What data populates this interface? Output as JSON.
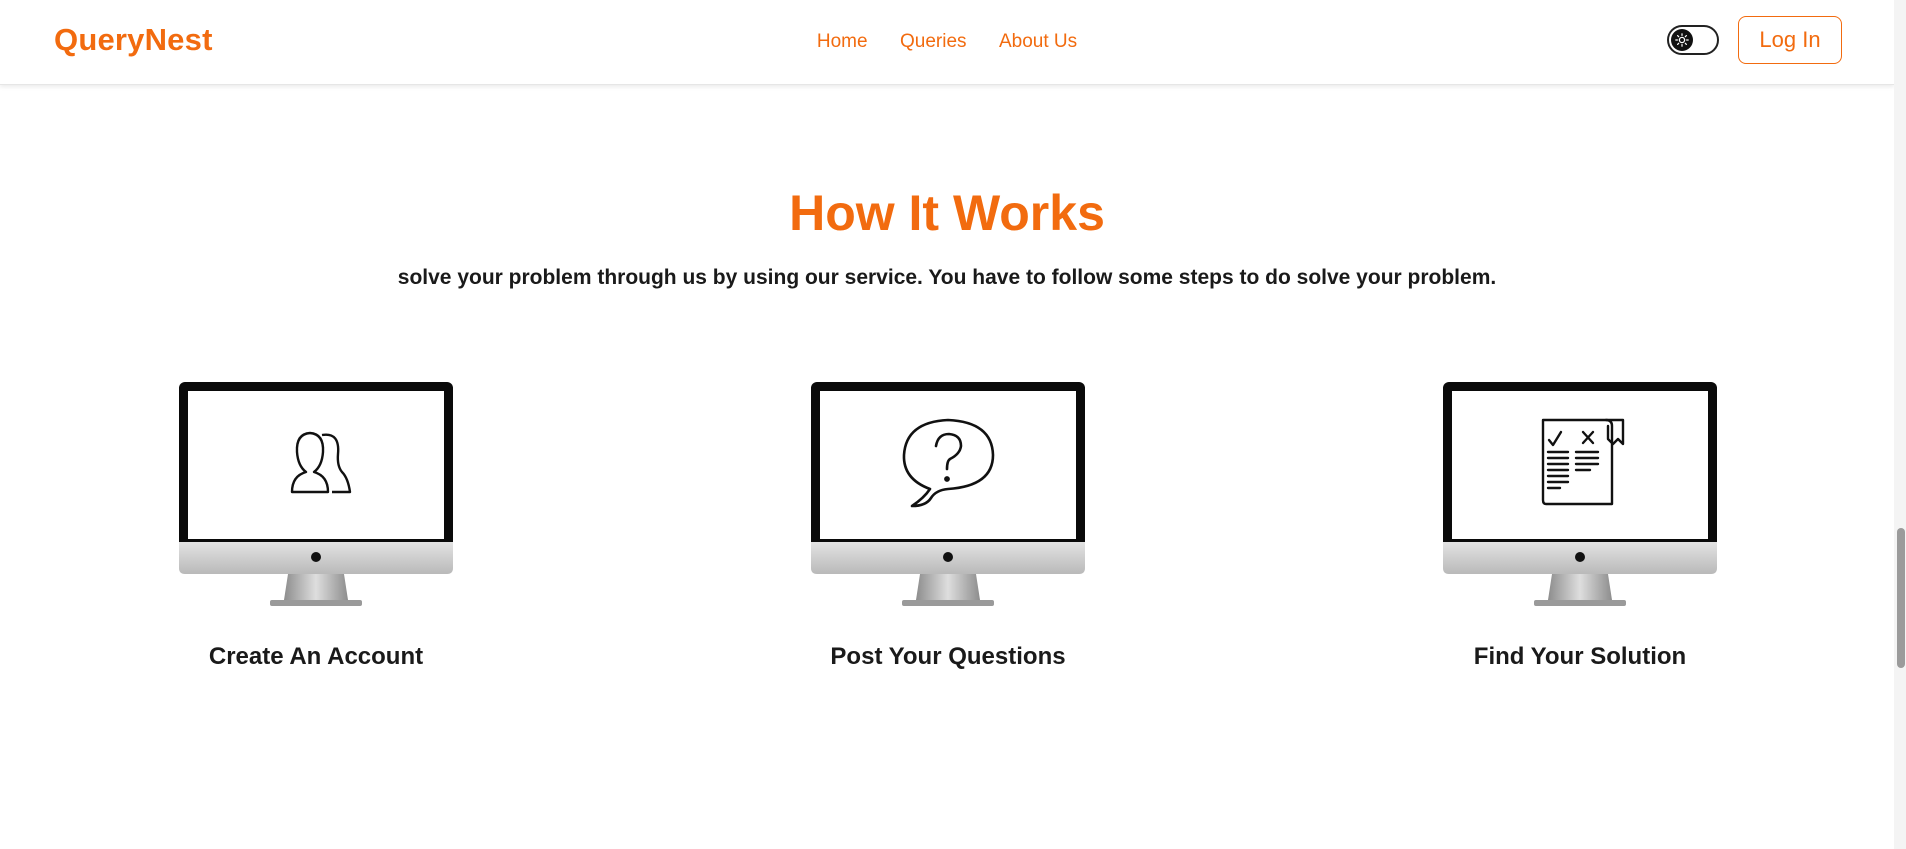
{
  "brand": {
    "name": "QueryNest",
    "accent": "#f26b0f"
  },
  "nav": {
    "links": [
      {
        "label": "Home"
      },
      {
        "label": "Queries"
      },
      {
        "label": "About Us"
      }
    ],
    "theme_toggle_icon": "sun-icon",
    "login_label": "Log In"
  },
  "how_it_works": {
    "title": "How It Works",
    "subtitle": "solve your problem through us by using our service. You have to follow some steps to do solve your problem.",
    "steps": [
      {
        "title": "Create An Account",
        "icon": "users-icon"
      },
      {
        "title": "Post Your Questions",
        "icon": "question-bubble-icon"
      },
      {
        "title": "Find Your Solution",
        "icon": "checklist-document-icon"
      }
    ]
  }
}
